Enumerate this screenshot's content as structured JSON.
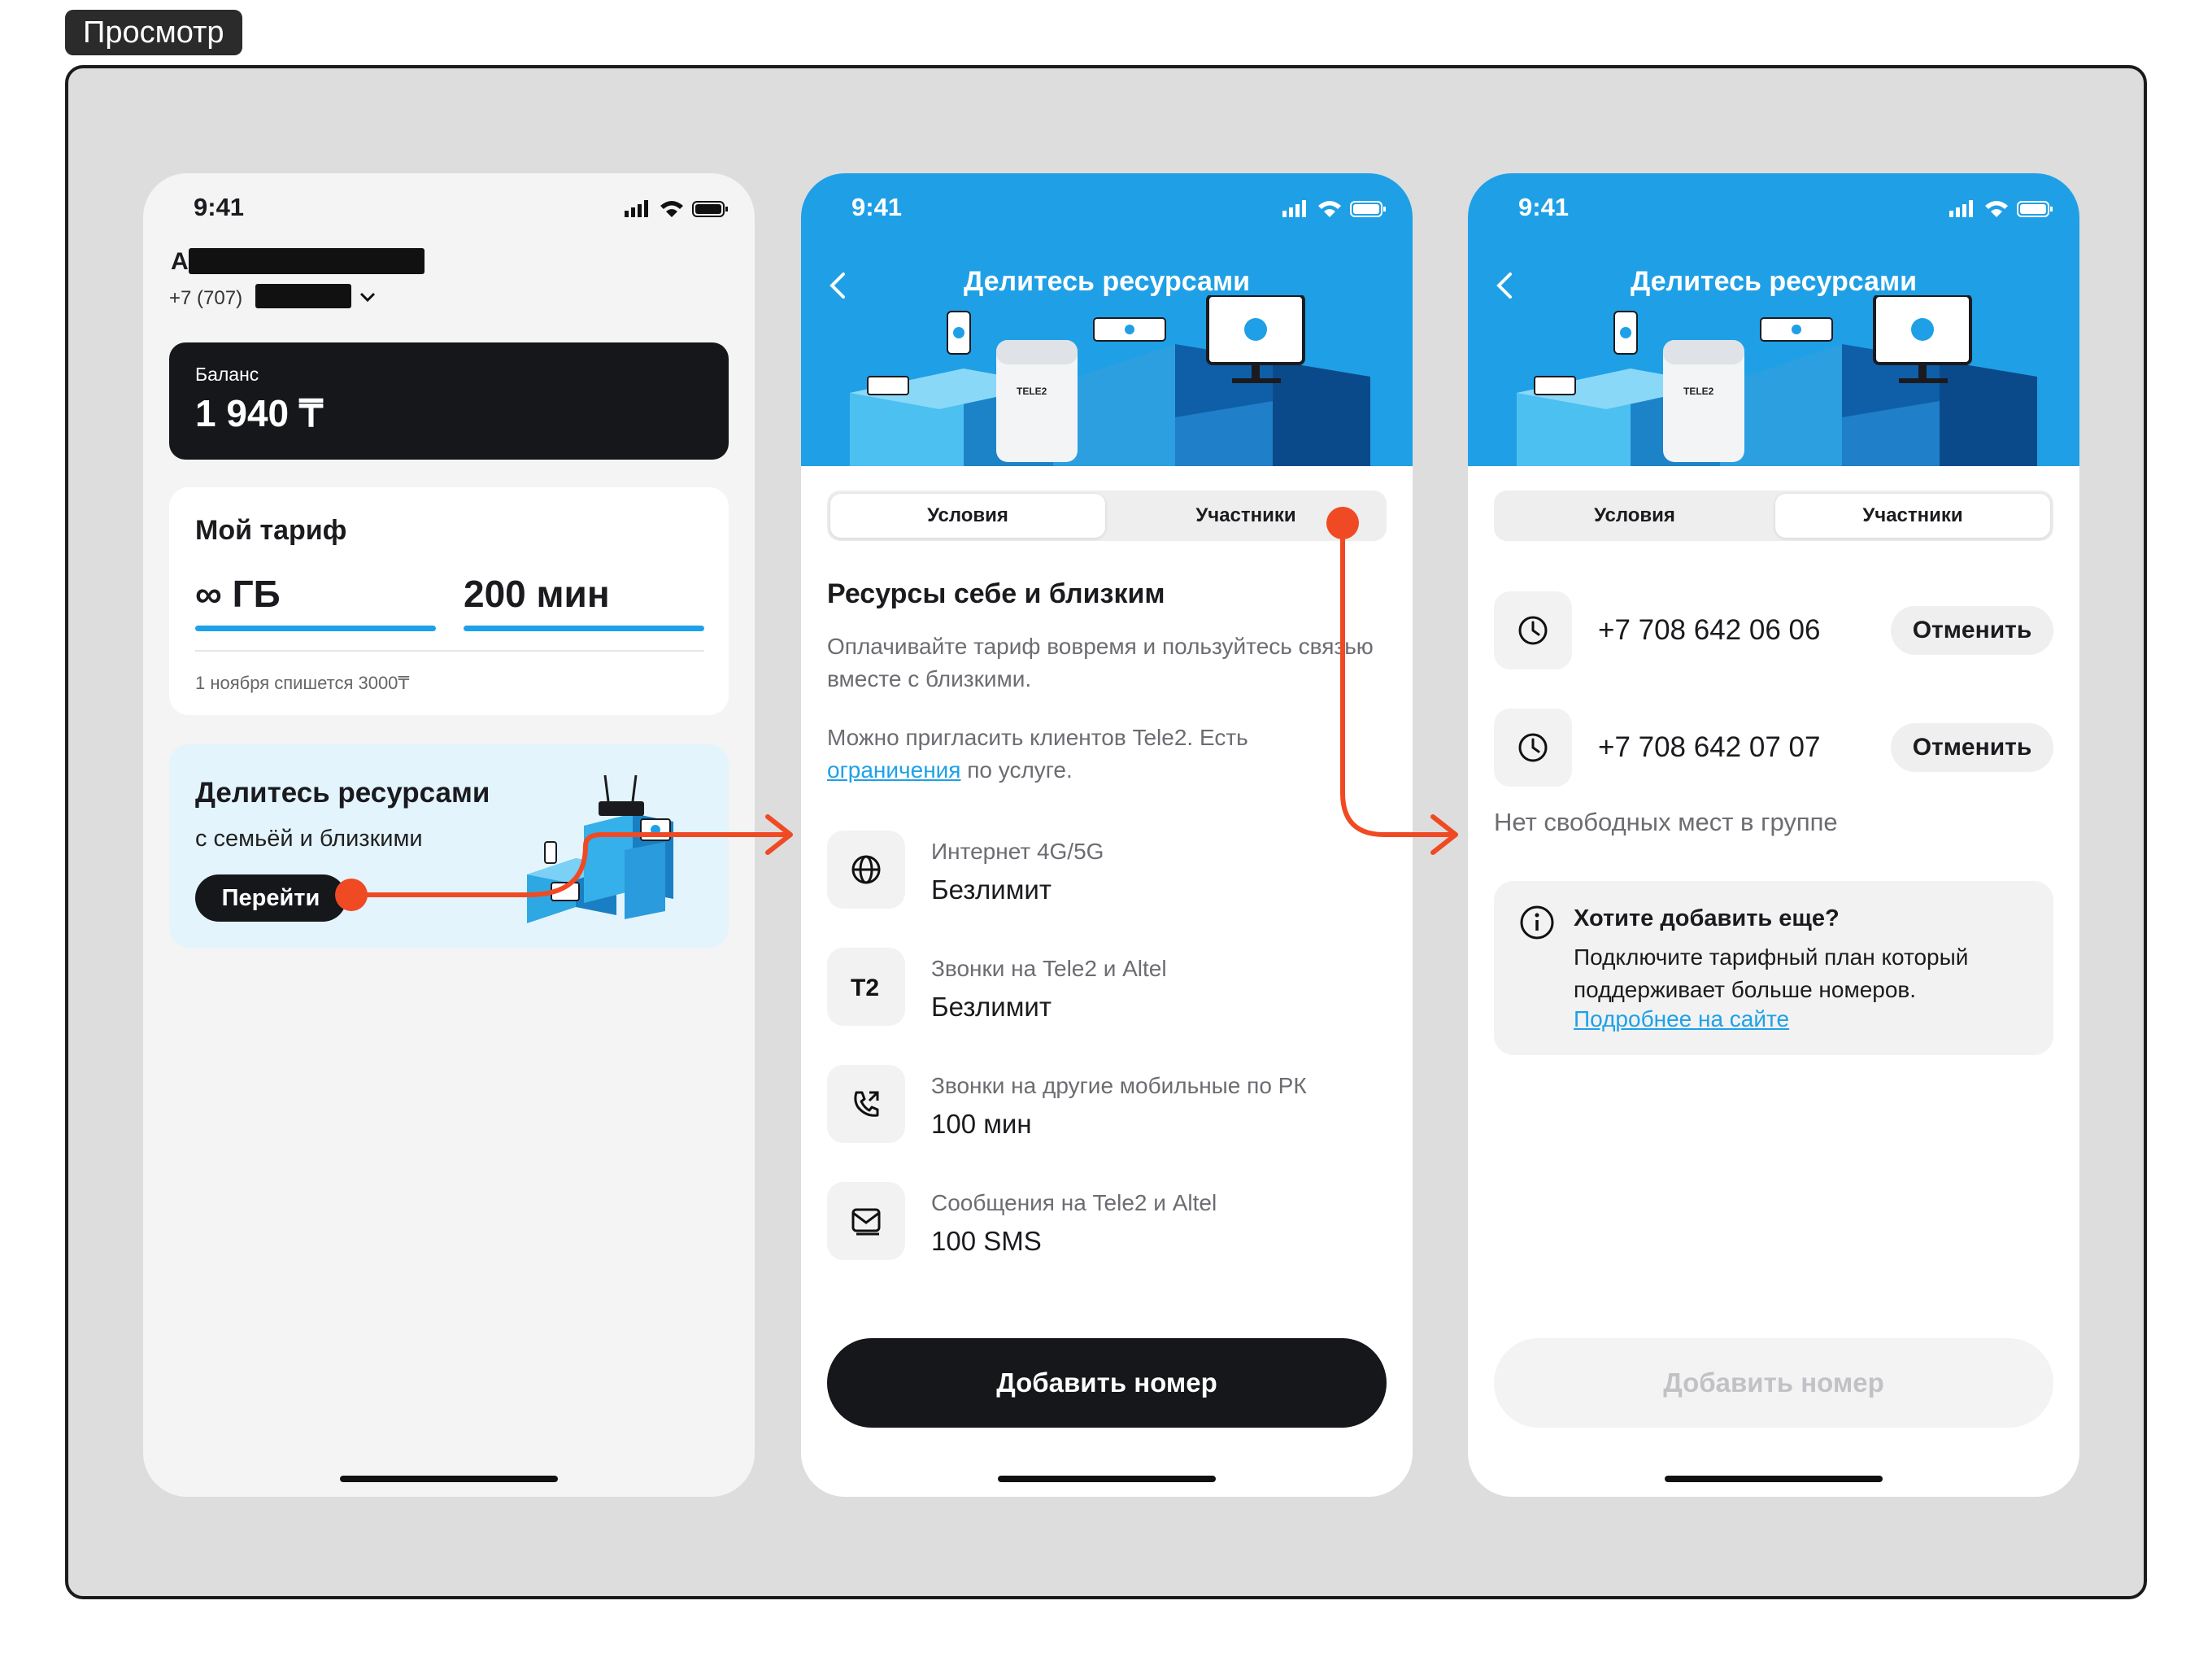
{
  "preview_tag": "Просмотр",
  "status_time": "9:41",
  "home": {
    "user_initial": "А",
    "phone_prefix": "+7 (707)",
    "balance_label": "Баланс",
    "balance_value": "1 940 ₸",
    "tariff_title": "Мой тариф",
    "tariff_gb": "∞ ГБ",
    "tariff_min": "200 мин",
    "tariff_note": "1 ноября спишется 3000₸",
    "promo_title": "Делитесь ресурсами",
    "promo_subtitle": "с семьёй и близкими",
    "promo_button": "Перейти"
  },
  "share": {
    "title": "Делитесь ресурсами",
    "tabs": [
      "Условия",
      "Участники"
    ],
    "heading": "Ресурсы себе и близким",
    "para1": "Оплачивайте тариф вовремя и пользуйтесь связью вместе с близкими.",
    "para2_text": "Можно пригласить клиентов Tele2. Есть",
    "para2_link": "ограничения",
    "para2_tail": "по услуге.",
    "features": [
      {
        "icon": "globe-icon",
        "title": "Интернет 4G/5G",
        "value": "Безлимит"
      },
      {
        "icon": "t2-logo-icon",
        "title": "Звонки на Tele2 и Altel",
        "value": "Безлимит"
      },
      {
        "icon": "phone-call-icon",
        "title": "Звонки на другие мобильные по РК",
        "value": "100 мин"
      },
      {
        "icon": "message-icon",
        "title": "Сообщения на Tele2 и Altel",
        "value": "100 SMS"
      }
    ],
    "add_button": "Добавить номер"
  },
  "participants": {
    "title": "Делитесь ресурсами",
    "tabs": [
      "Условия",
      "Участники"
    ],
    "members": [
      {
        "phone": "+7 708 642 06 06",
        "action": "Отменить"
      },
      {
        "phone": "+7 708 642 07 07",
        "action": "Отменить"
      }
    ],
    "no_slots": "Нет свободных мест в группе",
    "info_title": "Хотите добавить еще?",
    "info_text": "Подключите тарифный план который поддерживает больше номеров.",
    "info_link": "Подробнее на сайте",
    "add_button": "Добавить номер"
  },
  "colors": {
    "brand_blue": "#1fa0e6",
    "flow_arrow": "#f04a24",
    "link": "#1da1e8",
    "dark": "#15171a"
  }
}
